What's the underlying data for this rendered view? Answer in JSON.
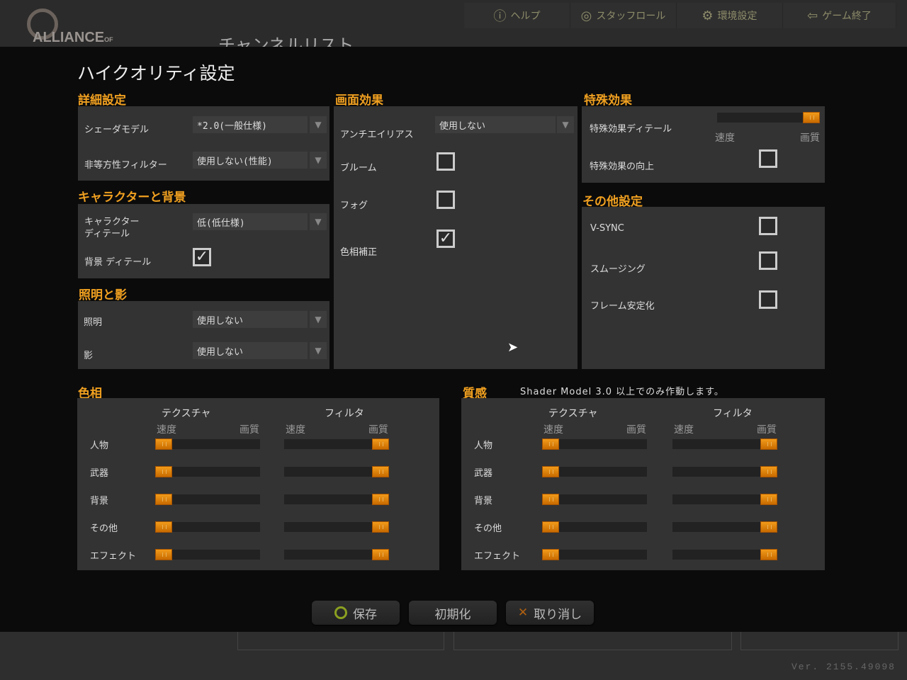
{
  "topbar": {
    "logo": "ALLIANCE OF VALIANT ARMS",
    "channel_title": "チャンネルリスト",
    "nav": [
      {
        "label": "ヘルプ",
        "icon": "help-icon"
      },
      {
        "label": "スタッフロール",
        "icon": "staff-icon"
      },
      {
        "label": "環境設定",
        "icon": "gear-icon"
      },
      {
        "label": "ゲーム終了",
        "icon": "exit-icon"
      }
    ]
  },
  "dialog_title": "ハイクオリティ設定",
  "detail": {
    "heading": "詳細設定",
    "shader_label": "シェーダモデル",
    "shader_value": "*2.0(一般仕様)",
    "aniso_label": "非等方性フィルター",
    "aniso_value": "使用しない(性能)"
  },
  "character": {
    "heading": "キャラクターと背景",
    "char_detail_label1": "キャラクター",
    "char_detail_label2": "ディテール",
    "char_detail_value": "低(低仕様)",
    "bg_detail_label": "背景 ディテール",
    "bg_detail_checked": true
  },
  "lighting": {
    "heading": "照明と影",
    "light_label": "照明",
    "light_value": "使用しない",
    "shadow_label": "影",
    "shadow_value": "使用しない"
  },
  "screen": {
    "heading": "画面効果",
    "aa_label": "アンチエイリアス",
    "aa_value": "使用しない",
    "bloom_label": "ブルーム",
    "bloom_checked": false,
    "fog_label": "フォグ",
    "fog_checked": false,
    "color_label": "色相補正",
    "color_checked": true
  },
  "special": {
    "heading": "特殊効果",
    "detail_label": "特殊効果ディテール",
    "detail_level": 1.0,
    "speed": "速度",
    "quality": "画質",
    "enhance_label": "特殊効果の向上",
    "enhance_checked": false
  },
  "other": {
    "heading": "その他設定",
    "vsync_label": "V-SYNC",
    "vsync_checked": false,
    "smooth_label": "スムージング",
    "smooth_checked": false,
    "frame_label": "フレーム安定化",
    "frame_checked": false
  },
  "hue": {
    "heading": "色相",
    "texture": "テクスチャ",
    "filter": "フィルタ",
    "speed": "速度",
    "quality": "画質",
    "rows": [
      {
        "label": "人物",
        "texture": 0,
        "filter": 1
      },
      {
        "label": "武器",
        "texture": 0,
        "filter": 1
      },
      {
        "label": "背景",
        "texture": 0,
        "filter": 1
      },
      {
        "label": "その他",
        "texture": 0,
        "filter": 1
      },
      {
        "label": "エフェクト",
        "texture": 0,
        "filter": 1
      }
    ]
  },
  "material": {
    "heading": "質感",
    "note": "Shader Model 3.0 以上でのみ作動します。",
    "texture": "テクスチャ",
    "filter": "フィルタ",
    "speed": "速度",
    "quality": "画質",
    "rows": [
      {
        "label": "人物",
        "texture": 0,
        "filter": 1
      },
      {
        "label": "武器",
        "texture": 0,
        "filter": 1
      },
      {
        "label": "背景",
        "texture": 0,
        "filter": 1
      },
      {
        "label": "その他",
        "texture": 0,
        "filter": 1
      },
      {
        "label": "エフェクト",
        "texture": 0,
        "filter": 1
      }
    ]
  },
  "buttons": {
    "save": "保存",
    "reset": "初期化",
    "cancel": "取り消し"
  },
  "version": "Ver. 2155.49098",
  "colors": {
    "accent": "#f0a020",
    "panel": "#333333",
    "save_icon": "#8aa020",
    "cancel_icon": "#b06010"
  }
}
